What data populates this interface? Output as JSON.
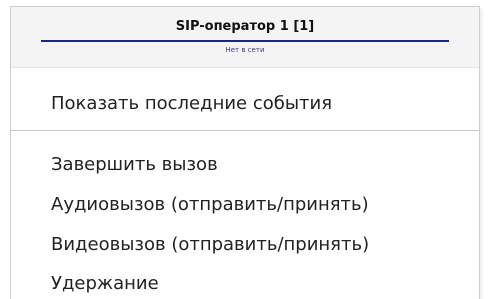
{
  "menu": {
    "title": "SIP-оператор 1 [1]",
    "status": "Нет в сети",
    "items": [
      {
        "label": "Показать последние события"
      },
      {
        "label": "Завершить вызов"
      },
      {
        "label": "Аудиовызов (отправить/принять)"
      },
      {
        "label": "Видеовызов (отправить/принять)"
      },
      {
        "label": "Удержание"
      }
    ]
  }
}
